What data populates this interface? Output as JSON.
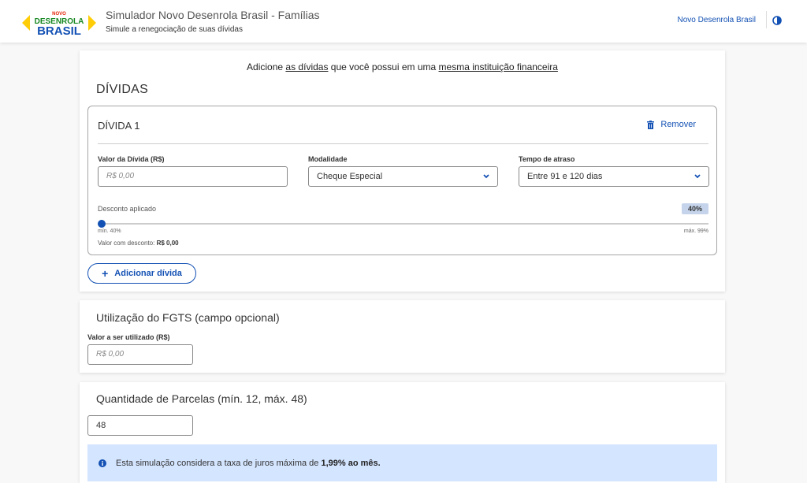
{
  "header": {
    "logo": {
      "top_text": "NOVO",
      "middle_text": "DESENROLA",
      "bottom_text": "BRASIL"
    },
    "title": "Simulador Novo Desenrola Brasil - Famílias",
    "subtitle": "Simule a renegociação de suas dívidas",
    "link": "Novo Desenrola Brasil",
    "contrast_icon": "contrast-icon"
  },
  "dividas": {
    "intro": {
      "part1": "Adicione ",
      "link1": "as dívidas",
      "part2": " que você possui em uma ",
      "link2": "mesma instituição financeira"
    },
    "title": "DÍVIDAS",
    "items": [
      {
        "title": "DÍVIDA 1",
        "remove_label": "Remover",
        "valor_label": "Valor da Dívida (R$)",
        "valor_placeholder": "R$ 0,00",
        "modalidade_label": "Modalidade",
        "modalidade_value": "Cheque Especial",
        "tempo_label": "Tempo de atraso",
        "tempo_value": "Entre 91 e 120 dias",
        "desconto_label": "Desconto aplicado",
        "desconto_badge": "40%",
        "desconto_value": 0.4,
        "slider_min": "mín. 40%",
        "slider_max": "máx. 99%",
        "valor_desconto_label": "Valor com desconto:",
        "valor_desconto_value": "R$ 0,00"
      }
    ],
    "add_label": "Adicionar dívida"
  },
  "fgts": {
    "title": "Utilização do FGTS (campo opcional)",
    "label": "Valor a ser utilizado (R$)",
    "placeholder": "R$ 0,00"
  },
  "parcelas": {
    "title": "Quantidade de Parcelas (mín. 12, máx. 48)",
    "value": "48",
    "info_text": "Esta simulação considera a taxa de juros máxima de ",
    "info_rate": "1,99% ao mês."
  },
  "colors": {
    "primary": "#1351b4",
    "info_bg": "#d4e5ff",
    "logo_yellow": "#ffcd07",
    "logo_green": "#168821"
  }
}
